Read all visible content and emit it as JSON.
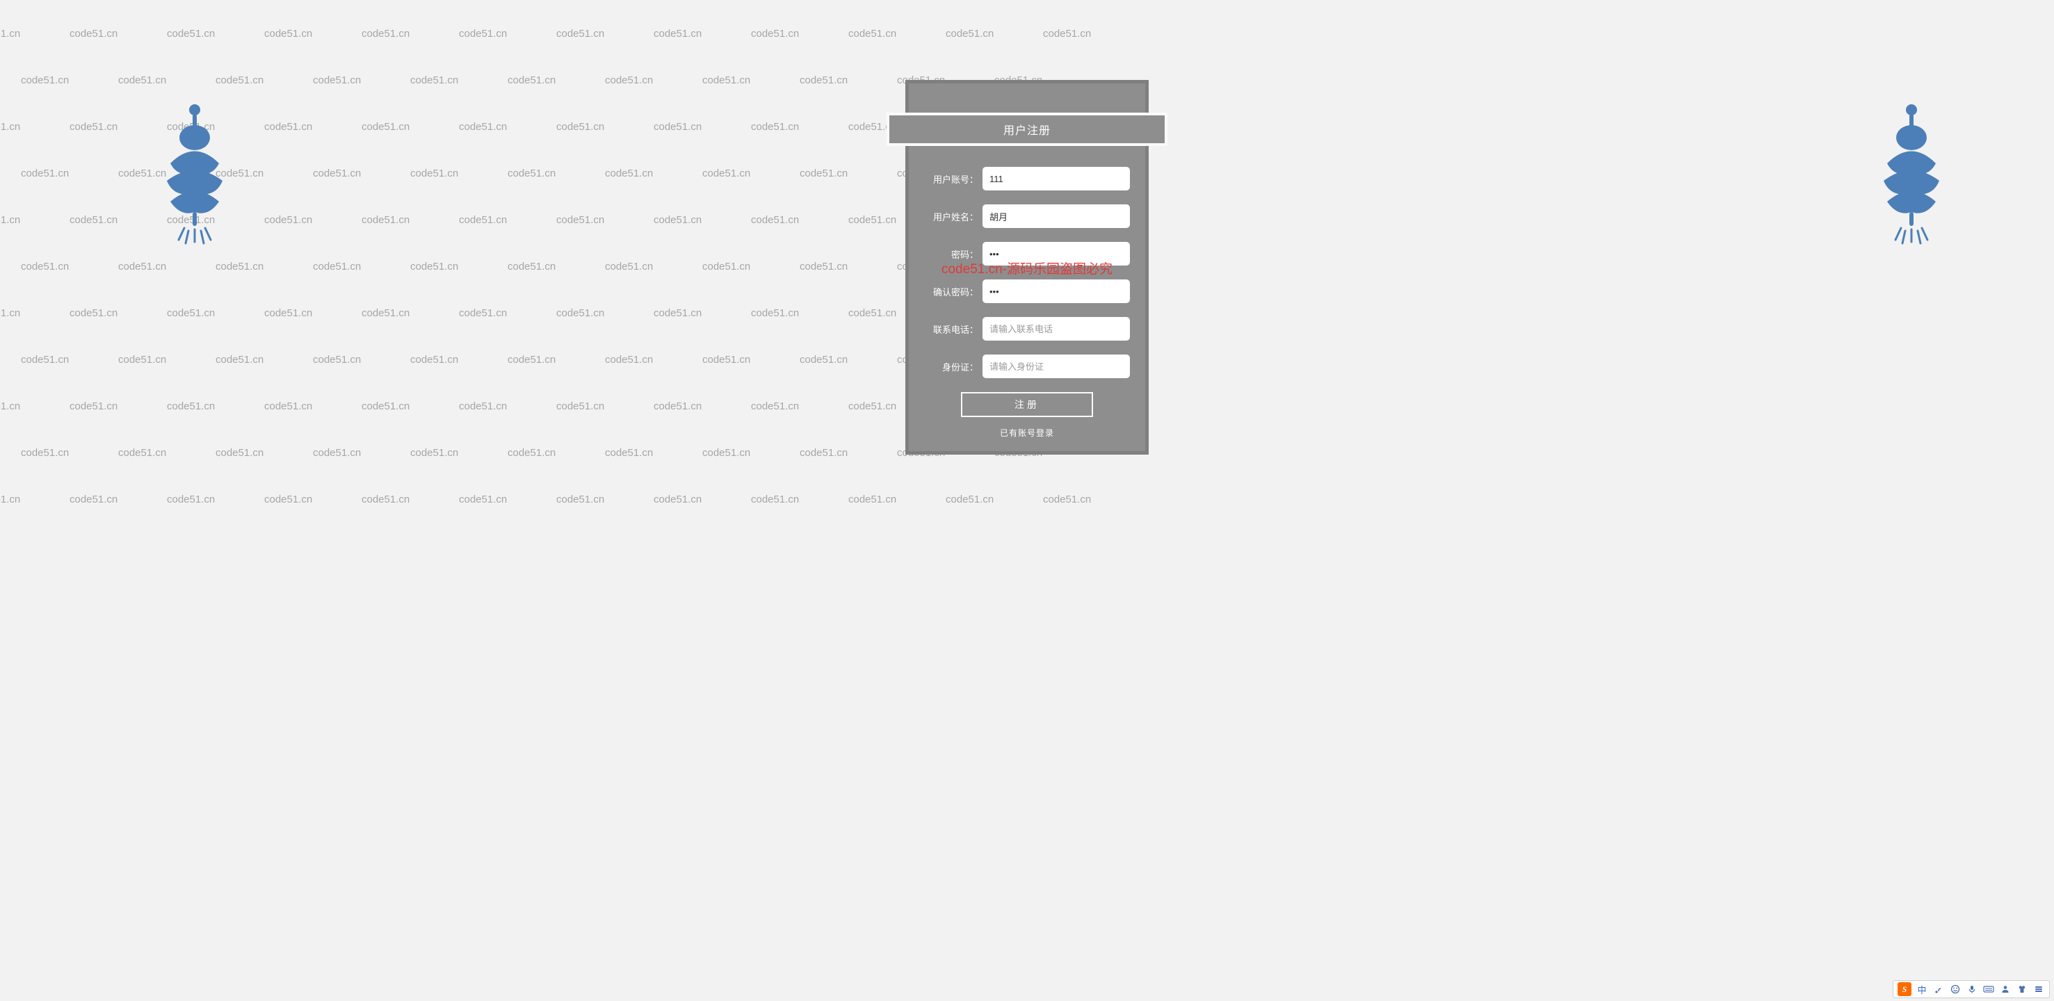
{
  "watermark_text": "code51.cn",
  "center_watermark": "code51.cn-源码乐园盗图必究",
  "form": {
    "title": "用户注册",
    "fields": {
      "account": {
        "label": "用户账号：",
        "value": "111",
        "placeholder": ""
      },
      "name": {
        "label": "用户姓名：",
        "value": "胡月",
        "placeholder": ""
      },
      "password": {
        "label": "密码：",
        "value": "•••",
        "placeholder": ""
      },
      "confirm": {
        "label": "确认密码：",
        "value": "•••",
        "placeholder": ""
      },
      "phone": {
        "label": "联系电话：",
        "value": "",
        "placeholder": "请输入联系电话"
      },
      "idcard": {
        "label": "身份证：",
        "value": "",
        "placeholder": "请输入身份证"
      }
    },
    "submit_label": "注册",
    "login_link_label": "已有账号登录"
  },
  "tray": {
    "ime_logo": "S",
    "lang": "中",
    "icons": [
      "punct",
      "smile",
      "mic",
      "keyboard",
      "person",
      "shirt",
      "settings"
    ]
  }
}
